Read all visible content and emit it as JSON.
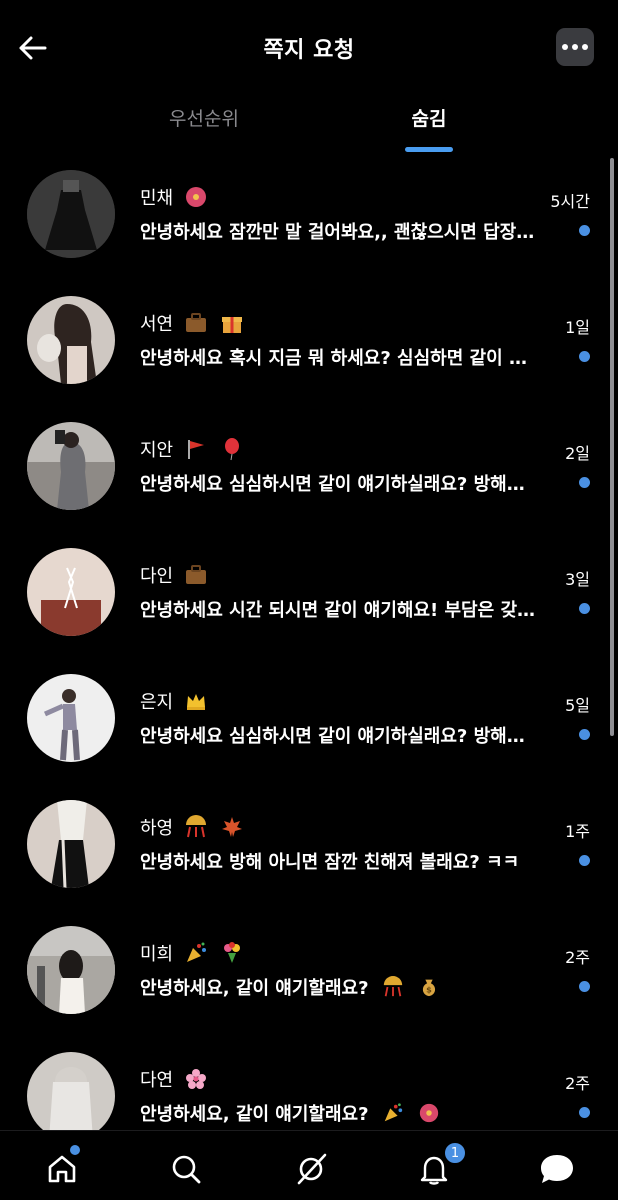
{
  "header": {
    "title": "쪽지 요청",
    "back_icon": "arrow-left-icon",
    "more_icon": "more-horizontal-icon"
  },
  "tabs": [
    {
      "label": "우선순위",
      "active": false
    },
    {
      "label": "숨김",
      "active": true
    }
  ],
  "conversations": [
    {
      "name": "민채",
      "emojis": [
        "hibiscus"
      ],
      "message": "안녕하세요 잠깐만 말 걸어봐요,, 괜찮으시면 답장 주세요",
      "time": "5시간",
      "unread": true
    },
    {
      "name": "서연",
      "emojis": [
        "briefcase",
        "gift"
      ],
      "message": "안녕하세요 혹시 지금 뭐 하세요? 심심하면 같이 얘기해요",
      "time": "1일",
      "unread": true
    },
    {
      "name": "지안",
      "emojis": [
        "triangular-flag",
        "balloon"
      ],
      "message": "안녕하세요 심심하시면 같이 얘기하실래요? 방해된다면 죄송해요",
      "time": "2일",
      "unread": true
    },
    {
      "name": "다인",
      "emojis": [
        "briefcase"
      ],
      "message": "안녕하세요 시간 되시면 같이 얘기해요! 부담은 갖지 마세요",
      "time": "3일",
      "unread": true
    },
    {
      "name": "은지",
      "emojis": [
        "crown"
      ],
      "message": "안녕하세요 심심하시면 같이 얘기하실래요? 방해된다면 죄송해요",
      "time": "5일",
      "unread": true
    },
    {
      "name": "하영",
      "emojis": [
        "confetti-ball",
        "maple-leaf"
      ],
      "message": "안녕하세요 방해 아니면 잠깐 친해져 볼래요? ㅋㅋ",
      "time": "1주",
      "unread": true
    },
    {
      "name": "미희",
      "emojis": [
        "party-popper",
        "bouquet"
      ],
      "message": "안녕하세요, 같이 얘기할래요?",
      "message_emojis": [
        "confetti-ball",
        "money-bag"
      ],
      "time": "2주",
      "unread": true
    },
    {
      "name": "다연",
      "emojis": [
        "cherry-blossom"
      ],
      "message": "안녕하세요, 같이 얘기할래요?",
      "message_emojis": [
        "party-popper",
        "hibiscus"
      ],
      "time": "2주",
      "unread": true
    }
  ],
  "navbar": {
    "items": [
      "home-icon",
      "search-icon",
      "grok-icon",
      "bell-icon",
      "messages-icon"
    ],
    "notification_count": "1"
  },
  "colors": {
    "background": "#000000",
    "accent": "#4a90e2",
    "muted_text": "#8a8a8e"
  }
}
